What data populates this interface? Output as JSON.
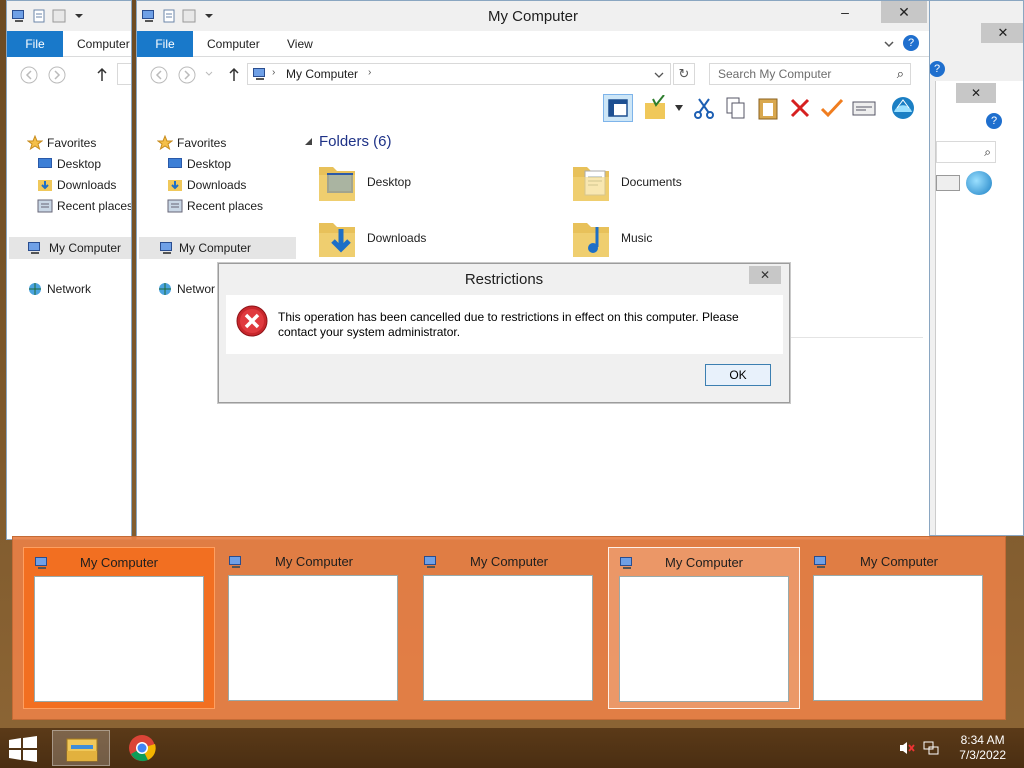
{
  "window": {
    "title": "My Computer",
    "tabs": {
      "file": "File",
      "computer": "Computer",
      "view": "View"
    },
    "address": "My Computer",
    "search_placeholder": "Search My Computer",
    "min": "–",
    "close": "✕"
  },
  "nav": {
    "favorites": "Favorites",
    "desktop": "Desktop",
    "downloads": "Downloads",
    "recent": "Recent places",
    "my_computer": "My Computer",
    "network": "Network",
    "network_cut": "Networ"
  },
  "content": {
    "group_title": "Folders (6)",
    "folders": [
      "Desktop",
      "Documents",
      "Downloads",
      "Music"
    ]
  },
  "dialog": {
    "title": "Restrictions",
    "message": "This operation has been cancelled due to restrictions in effect on this computer. Please contact your system administrator.",
    "ok": "OK",
    "close": "✕"
  },
  "switcher": {
    "items": [
      "My Computer",
      "My Computer",
      "My Computer",
      "My Computer",
      "My Computer"
    ]
  },
  "taskbar": {
    "time": "8:34 AM",
    "date": "7/3/2022"
  },
  "colors": {
    "file_tab": "#1979ca",
    "switcher_bg": "#e88046",
    "selected_thumb": "#f26f21",
    "link_blue": "#1e3287"
  }
}
